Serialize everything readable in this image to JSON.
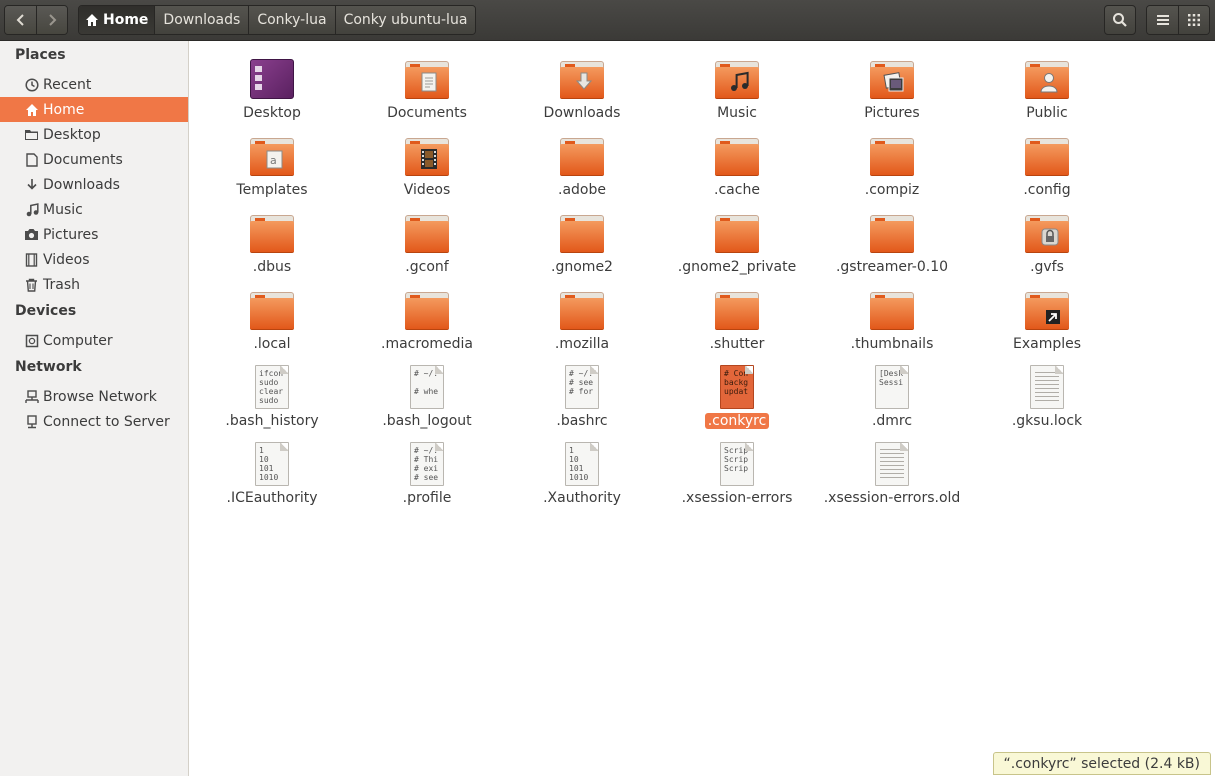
{
  "header": {
    "breadcrumbs": [
      "Home",
      "Downloads",
      "Conky-lua",
      "Conky ubuntu-lua"
    ]
  },
  "sidebar": {
    "sections": [
      {
        "title": "Places",
        "items": [
          {
            "label": "Recent",
            "icon": "clock-icon"
          },
          {
            "label": "Home",
            "icon": "home-icon",
            "active": true
          },
          {
            "label": "Desktop",
            "icon": "desktop-folder-icon"
          },
          {
            "label": "Documents",
            "icon": "document-icon"
          },
          {
            "label": "Downloads",
            "icon": "download-icon"
          },
          {
            "label": "Music",
            "icon": "music-icon"
          },
          {
            "label": "Pictures",
            "icon": "camera-icon"
          },
          {
            "label": "Videos",
            "icon": "film-icon"
          },
          {
            "label": "Trash",
            "icon": "trash-icon"
          }
        ]
      },
      {
        "title": "Devices",
        "items": [
          {
            "label": "Computer",
            "icon": "computer-icon"
          }
        ]
      },
      {
        "title": "Network",
        "items": [
          {
            "label": "Browse Network",
            "icon": "network-icon"
          },
          {
            "label": "Connect to Server",
            "icon": "server-icon"
          }
        ]
      }
    ]
  },
  "files": [
    {
      "name": "Desktop",
      "kind": "desktop"
    },
    {
      "name": "Documents",
      "kind": "folder",
      "emblem": "document-emblem"
    },
    {
      "name": "Downloads",
      "kind": "folder",
      "emblem": "download-emblem"
    },
    {
      "name": "Music",
      "kind": "folder",
      "emblem": "music-emblem"
    },
    {
      "name": "Pictures",
      "kind": "folder",
      "emblem": "pictures-emblem"
    },
    {
      "name": "Public",
      "kind": "folder",
      "emblem": "person-emblem"
    },
    {
      "name": "Templates",
      "kind": "folder",
      "emblem": "template-emblem"
    },
    {
      "name": "Videos",
      "kind": "folder",
      "emblem": "film-emblem"
    },
    {
      "name": ".adobe",
      "kind": "folder"
    },
    {
      "name": ".cache",
      "kind": "folder"
    },
    {
      "name": ".compiz",
      "kind": "folder"
    },
    {
      "name": ".config",
      "kind": "folder"
    },
    {
      "name": ".dbus",
      "kind": "folder"
    },
    {
      "name": ".gconf",
      "kind": "folder"
    },
    {
      "name": ".gnome2",
      "kind": "folder"
    },
    {
      "name": ".gnome2_private",
      "kind": "folder"
    },
    {
      "name": ".gstreamer-0.10",
      "kind": "folder"
    },
    {
      "name": ".gvfs",
      "kind": "folder",
      "emblem": "lock-emblem"
    },
    {
      "name": ".local",
      "kind": "folder"
    },
    {
      "name": ".macromedia",
      "kind": "folder"
    },
    {
      "name": ".mozilla",
      "kind": "folder"
    },
    {
      "name": ".shutter",
      "kind": "folder"
    },
    {
      "name": ".thumbnails",
      "kind": "folder"
    },
    {
      "name": "Examples",
      "kind": "folder",
      "emblem": "link-emblem"
    },
    {
      "name": ".bash_history",
      "kind": "text",
      "preview": "ifcon\nsudo\nclear\nsudo"
    },
    {
      "name": ".bash_logout",
      "kind": "text",
      "preview": "# ~/.\n\n# whe"
    },
    {
      "name": ".bashrc",
      "kind": "text",
      "preview": "# ~/.\n# see\n# for"
    },
    {
      "name": ".conkyrc",
      "kind": "text",
      "preview": "# Con\nbackg\nupdat",
      "selected": true
    },
    {
      "name": ".dmrc",
      "kind": "text",
      "preview": "[Desk\nSessi"
    },
    {
      "name": ".gksu.lock",
      "kind": "blank"
    },
    {
      "name": ".ICEauthority",
      "kind": "text",
      "preview": "1\n10\n101\n1010"
    },
    {
      "name": ".profile",
      "kind": "text",
      "preview": "# ~/.\n# Thi\n# exi\n# see"
    },
    {
      "name": ".Xauthority",
      "kind": "text",
      "preview": "1\n10\n101\n1010"
    },
    {
      "name": ".xsession-errors",
      "kind": "text",
      "preview": "Scrip\nScrip\nScrip"
    },
    {
      "name": ".xsession-errors.old",
      "kind": "blank"
    }
  ],
  "status": {
    "text": "“.conkyrc” selected  (2.4 kB)"
  },
  "colors": {
    "accent": "#f07746",
    "folder": "#e2581a"
  }
}
